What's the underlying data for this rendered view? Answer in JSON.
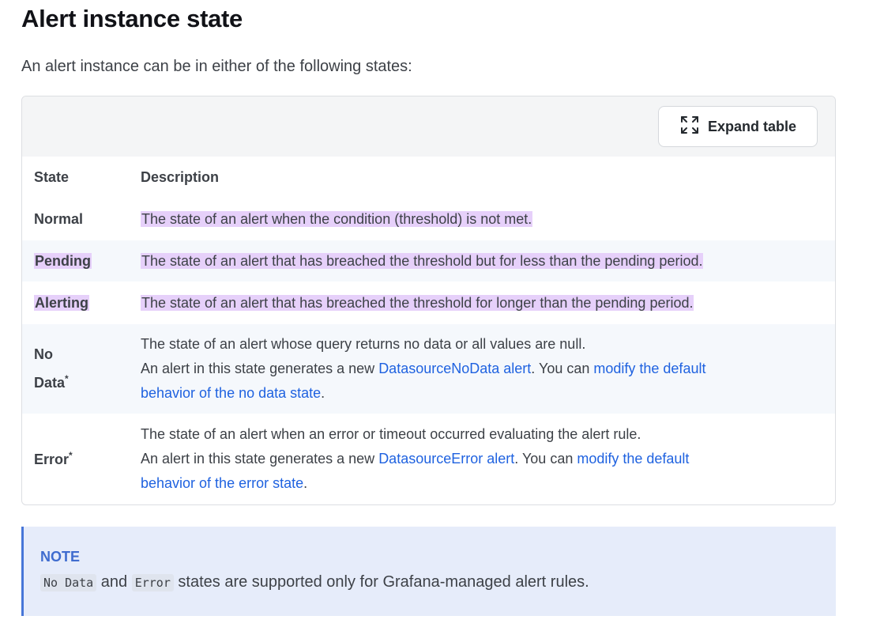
{
  "section": {
    "title": "Alert instance state",
    "intro": "An alert instance can be in either of the following states:"
  },
  "table": {
    "expand_label": "Expand table",
    "columns": [
      "State",
      "Description"
    ],
    "rows": [
      {
        "state": "Normal",
        "description": "The state of an alert when the condition (threshold) is not met."
      },
      {
        "state": "Pending",
        "description": "The state of an alert that has breached the threshold but for less than the pending period."
      },
      {
        "state": "Alerting",
        "description": "The state of an alert that has breached the threshold for longer than the pending period."
      },
      {
        "state_line1": "No",
        "state_line2": "Data",
        "state_sup": "*",
        "description": "The state of an alert whose query returns no data or all values are null.",
        "detail_prefix": "An alert in this state generates a new ",
        "detail_link": "DatasourceNoData alert",
        "detail_mid": ". You can ",
        "detail_link2_a": "modify the default",
        "detail_link2_b": "behavior of the no data state",
        "detail_suffix": "."
      },
      {
        "state": "Error",
        "state_sup": "*",
        "description": "The state of an alert when an error or timeout occurred evaluating the alert rule.",
        "detail_prefix": "An alert in this state generates a new ",
        "detail_link": "DatasourceError alert",
        "detail_mid": ". You can ",
        "detail_link2_a": "modify the default",
        "detail_link2_b": "behavior of the error state",
        "detail_suffix": "."
      }
    ]
  },
  "note": {
    "label": "NOTE",
    "code1": "No Data",
    "and": " and ",
    "code2": "Error",
    "text": " states are supported only for Grafana-managed alert rules."
  },
  "colors": {
    "highlight": "#e6d0fa",
    "link": "#1f62e0",
    "note_bg": "#e6ecfa",
    "note_accent": "#4776d8"
  }
}
